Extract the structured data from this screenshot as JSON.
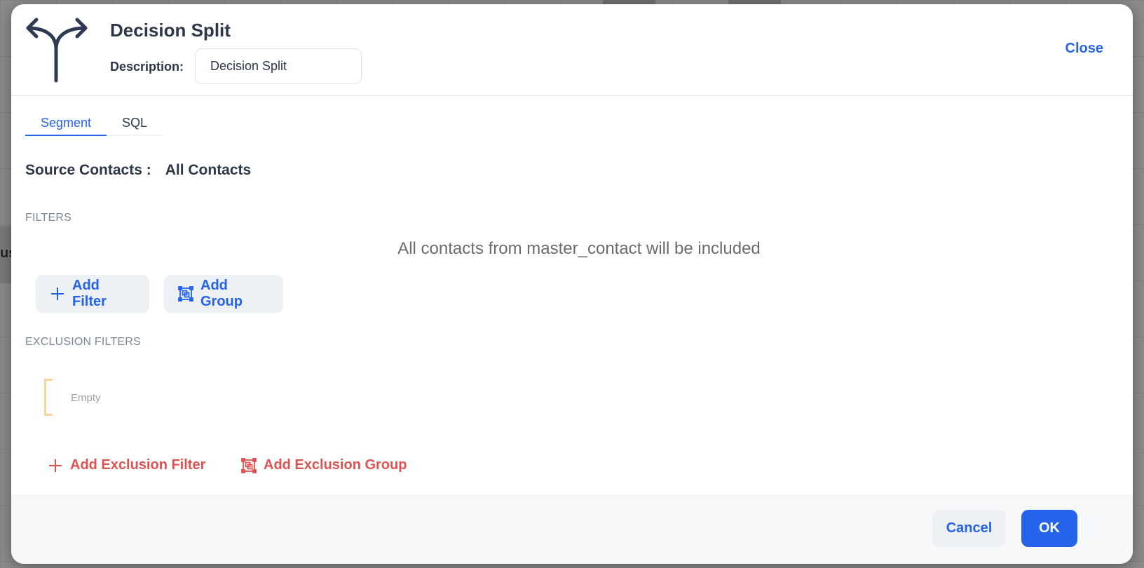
{
  "background": {
    "partial_text": "us"
  },
  "header": {
    "title": "Decision Split",
    "icon": "split-arrows-icon",
    "description_label": "Description:",
    "description_value": "Decision Split",
    "close_label": "Close"
  },
  "tabs": [
    {
      "label": "Segment",
      "active": true
    },
    {
      "label": "SQL",
      "active": false
    }
  ],
  "source": {
    "label": "Source Contacts :",
    "value": "All Contacts"
  },
  "filters": {
    "section_label": "FILTERS",
    "empty_message": "All contacts from master_contact will be included",
    "add_filter_label": "Add Filter",
    "add_filter_icon": "plus-icon",
    "add_group_label": "Add Group",
    "add_group_icon": "group-icon"
  },
  "exclusion_filters": {
    "section_label": "EXCLUSION FILTERS",
    "empty_label": "Empty",
    "add_exclusion_filter_label": "Add Exclusion Filter",
    "add_exclusion_group_label": "Add Exclusion Group"
  },
  "footer": {
    "cancel_label": "Cancel",
    "ok_label": "OK"
  },
  "colors": {
    "accent": "#2563eb",
    "danger": "#e05252",
    "text": "#2d3748",
    "bracket": "#f8d59a"
  }
}
